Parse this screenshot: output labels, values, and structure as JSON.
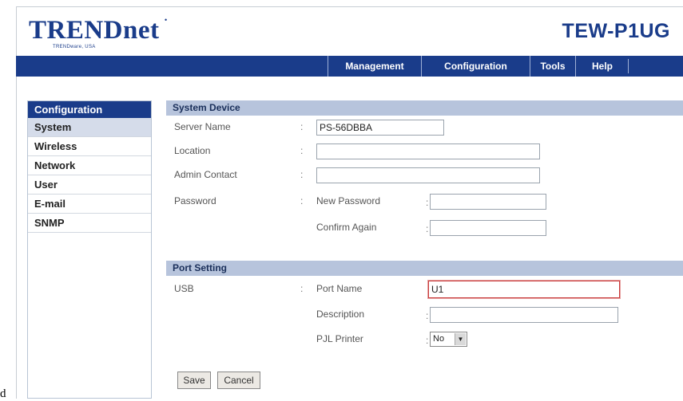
{
  "stray_char": "d",
  "brand": {
    "logo": "TRENDnet",
    "tagline": "TRENDware, USA",
    "model": "TEW-P1UG"
  },
  "nav": [
    "Management",
    "Configuration",
    "Tools",
    "Help"
  ],
  "sidebar": {
    "heading": "Configuration",
    "items": [
      "System",
      "Wireless",
      "Network",
      "User",
      "E-mail",
      "SNMP"
    ],
    "active": "System"
  },
  "system_device": {
    "heading": "System Device",
    "server_name_label": "Server Name",
    "server_name_value": "PS-56DBBA",
    "location_label": "Location",
    "location_value": "",
    "admin_contact_label": "Admin Contact",
    "admin_contact_value": "",
    "password_label": "Password",
    "new_password_label": "New Password",
    "confirm_again_label": "Confirm Again"
  },
  "port_setting": {
    "heading": "Port Setting",
    "port_label": "USB",
    "port_name_label": "Port Name",
    "port_name_value": "U1",
    "description_label": "Description",
    "description_value": "",
    "pjl_printer_label": "PJL Printer",
    "pjl_printer_value": "No"
  },
  "buttons": {
    "save": "Save",
    "cancel": "Cancel"
  },
  "colors": {
    "navy": "#1a3c8a",
    "section": "#b7c4dc",
    "highlight": "#c83b3b"
  }
}
